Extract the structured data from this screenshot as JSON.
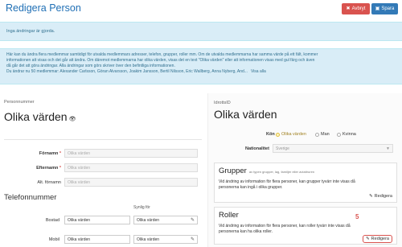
{
  "header": {
    "title": "Redigera Person",
    "cancel_label": "Avbryt",
    "save_label": "Spara",
    "cancel_color": "#d9534f",
    "save_color": "#337ab7"
  },
  "alerts": {
    "no_changes": "Inga ändringar är gjorda.",
    "info_line1": "Här kan du ändra flera medlemmar samtidigt för utvalda medlemmars adresser, telefon, grupper, roller mm. Om de utvalda medlemmarna har samma värde på ett fält, kommer",
    "info_line2": "informationen att visas och det går att ändra. Om däremot medlemmarna har olika värden, visas det en text \"Olika värden\" eller att informationen visas med gul färg och även",
    "info_line3": "då går det att göra ändringar. Alla ändringar som görs skriver över den befintliga informationen.",
    "info_line4": "Du ändrar nu 50 medlemmar: Alexander Carlsson, Göran Alvarsson, Joakim Jansson, Bertil Nilsson, Eric Wallberg, Anna Nyberg, And...",
    "show_all": "Visa alla"
  },
  "left": {
    "personnummer_label": "Personnummer",
    "personnummer_value": "Olika värden",
    "fields": [
      {
        "label": "Förnamn",
        "required": "*",
        "placeholder": "Olika värden"
      },
      {
        "label": "Efternamn",
        "required": "*",
        "placeholder": "Olika värden"
      },
      {
        "label": "Alt. förnamn",
        "required": "",
        "placeholder": "Olika värden"
      }
    ],
    "phone_section_title": "Telefonnummer",
    "visible_label": "Synlig för",
    "phones": [
      {
        "label": "Bostad",
        "value": "Olika värden",
        "visibility": "Olika värden"
      },
      {
        "label": "Mobil",
        "value": "Olika värden",
        "visibility": "Olika värden"
      }
    ]
  },
  "right": {
    "idrottsid_label": "IdrottsID",
    "idrottsid_value": "Olika värden",
    "gender_label": "Kön",
    "gender_options": [
      "Olika värden",
      "Man",
      "Kvinna"
    ],
    "gender_selected": "Olika värden",
    "nationality_label": "Nationalitet",
    "nationality_value": "Sverige",
    "grupper": {
      "title": "Grupper",
      "subtitle": "av typen grupper, lag, familjer eller avtaltruren",
      "text_line1": "Vid ändring av information för flera personer, kan grupper tyvärr inte visas då",
      "text_line2": "personerna kan ingå i olika grupper.",
      "edit_label": "Redigera"
    },
    "roller": {
      "title": "Roller",
      "text_line1": "Vid ändring av information för flera personer, kan roller tyvärr inte visas då",
      "text_line2": "personerna kan ha olika roller.",
      "edit_label": "Redigera",
      "marker": "5"
    }
  }
}
